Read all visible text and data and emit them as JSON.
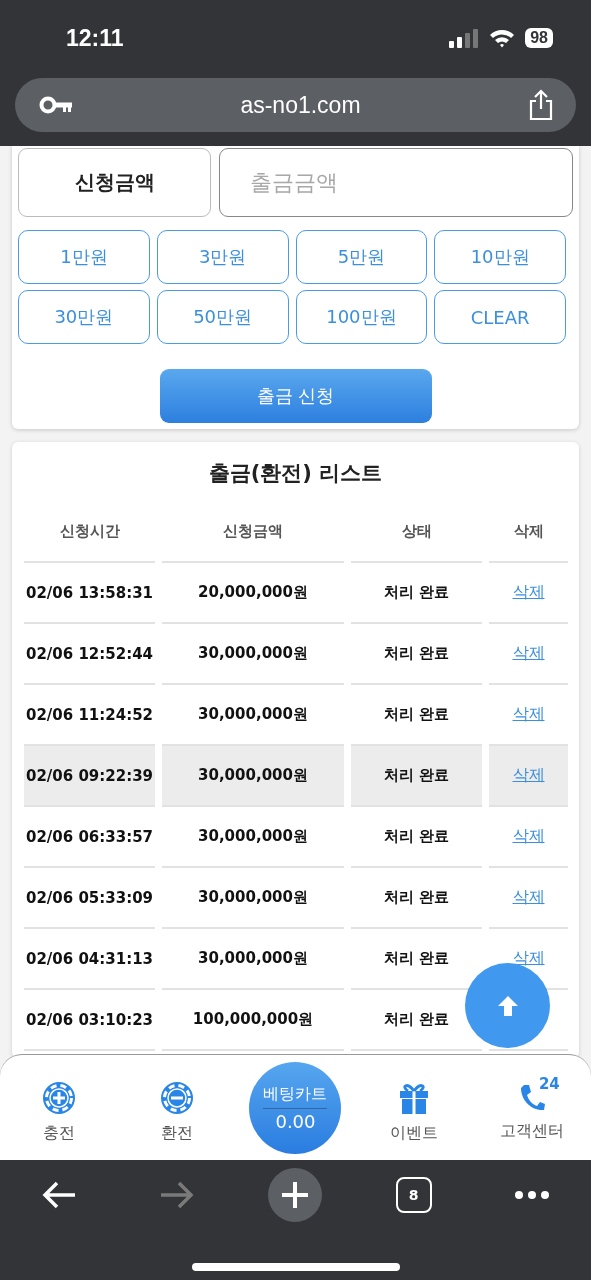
{
  "status_bar": {
    "time": "12:11",
    "battery": "98"
  },
  "address_bar": {
    "url": "as-no1.com"
  },
  "withdraw_form": {
    "label": "신청금액",
    "amount_placeholder": "출금금액",
    "quick_amounts": [
      "1만원",
      "3만원",
      "5만원",
      "10만원",
      "30만원",
      "50만원",
      "100만원",
      "CLEAR"
    ],
    "submit": "출금 신청"
  },
  "withdraw_list": {
    "title": "출금(환전) 리스트",
    "columns": [
      "신청시간",
      "신청금액",
      "상태",
      "삭제"
    ],
    "rows": [
      {
        "time": "02/06 13:58:31",
        "amount": "20,000,000원",
        "status": "처리 완료",
        "action": "삭제",
        "selected": false
      },
      {
        "time": "02/06 12:52:44",
        "amount": "30,000,000원",
        "status": "처리 완료",
        "action": "삭제",
        "selected": false
      },
      {
        "time": "02/06 11:24:52",
        "amount": "30,000,000원",
        "status": "처리 완료",
        "action": "삭제",
        "selected": false
      },
      {
        "time": "02/06 09:22:39",
        "amount": "30,000,000원",
        "status": "처리 완료",
        "action": "삭제",
        "selected": true
      },
      {
        "time": "02/06 06:33:57",
        "amount": "30,000,000원",
        "status": "처리 완료",
        "action": "삭제",
        "selected": false
      },
      {
        "time": "02/06 05:33:09",
        "amount": "30,000,000원",
        "status": "처리 완료",
        "action": "삭제",
        "selected": false
      },
      {
        "time": "02/06 04:31:13",
        "amount": "30,000,000원",
        "status": "처리 완료",
        "action": "삭제",
        "selected": false
      },
      {
        "time": "02/06 03:10:23",
        "amount": "100,000,000원",
        "status": "처리 완료",
        "selected": false
      }
    ]
  },
  "bottom_nav": [
    {
      "kind": "charge",
      "label": "충전"
    },
    {
      "kind": "exchange",
      "label": "환전"
    },
    {
      "kind": "cart",
      "label": "베팅카트",
      "value": "0.00"
    },
    {
      "kind": "event",
      "label": "이벤트"
    },
    {
      "kind": "support",
      "label": "고객센터",
      "badge": "24"
    }
  ],
  "browser_toolbar": {
    "tab_count": "8",
    "forward_disabled": true
  }
}
